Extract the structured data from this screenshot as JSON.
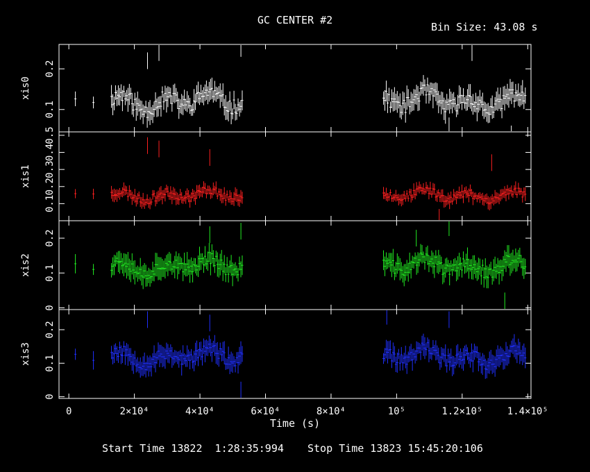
{
  "header": {
    "title": "GC CENTER #2",
    "bin_size": "Bin Size: 43.08 s",
    "x_axis_label": "Time (s)",
    "start_time": "Start Time 13822  1:28:35:994",
    "stop_time": "Stop Time 13823 15:45:20:106"
  },
  "chart_data": {
    "type": "line",
    "layout": "stacked-panels-sharing-x",
    "xlabel": "Time (s)",
    "xlim": [
      -3000,
      141000
    ],
    "x_ticks": [
      {
        "value": 0,
        "label": "0"
      },
      {
        "value": 20000,
        "label": "2×10⁴"
      },
      {
        "value": 40000,
        "label": "4×10⁴"
      },
      {
        "value": 60000,
        "label": "6×10⁴"
      },
      {
        "value": 80000,
        "label": "8×10⁴"
      },
      {
        "value": 100000,
        "label": "10⁵"
      },
      {
        "value": 120000,
        "label": "1.2×10⁵"
      },
      {
        "value": 140000,
        "label": "1.4×10⁵"
      }
    ],
    "segments": [
      [
        2000,
        2000
      ],
      [
        7500,
        7500
      ],
      [
        13000,
        53000
      ],
      [
        96000,
        139500
      ]
    ],
    "panels": [
      {
        "name": "xis0",
        "ylabel": "xis0",
        "color": "#ffffff",
        "ylim": [
          0.045,
          0.26
        ],
        "y_ticks": [
          {
            "value": 0.1,
            "label": "0.1"
          },
          {
            "value": 0.2,
            "label": "0.2"
          }
        ],
        "base": 0.12,
        "amp": 0.03,
        "err": 0.022,
        "seed": 11,
        "outliers": [
          [
            24000,
            0.22
          ],
          [
            27500,
            0.24
          ],
          [
            52500,
            0.25
          ],
          [
            116000,
            0.06
          ],
          [
            123000,
            0.24
          ],
          [
            135000,
            0.04
          ]
        ]
      },
      {
        "name": "xis1",
        "ylabel": "xis1",
        "color": "#ff2020",
        "ylim": [
          0.0,
          0.52
        ],
        "y_ticks": [
          {
            "value": 0.1,
            "label": "0.1"
          },
          {
            "value": 0.2,
            "label": "0.2"
          },
          {
            "value": 0.3,
            "label": "0.3"
          },
          {
            "value": 0.4,
            "label": "0.4"
          },
          {
            "value": 0.5,
            "label": "0.5"
          }
        ],
        "base": 0.15,
        "amp": 0.04,
        "err": 0.03,
        "seed": 23,
        "outliers": [
          [
            24000,
            0.44
          ],
          [
            27500,
            0.42
          ],
          [
            43000,
            0.37
          ],
          [
            113000,
            0.02
          ],
          [
            129000,
            0.34
          ]
        ]
      },
      {
        "name": "xis2",
        "ylabel": "xis2",
        "color": "#22ee22",
        "ylim": [
          -0.005,
          0.25
        ],
        "y_ticks": [
          {
            "value": 0,
            "label": "0"
          },
          {
            "value": 0.1,
            "label": "0.1"
          },
          {
            "value": 0.2,
            "label": "0.2"
          }
        ],
        "base": 0.12,
        "amp": 0.03,
        "err": 0.025,
        "seed": 37,
        "outliers": [
          [
            43000,
            0.21
          ],
          [
            52500,
            0.22
          ],
          [
            106000,
            0.2
          ],
          [
            116000,
            0.23
          ],
          [
            133000,
            0.02
          ]
        ]
      },
      {
        "name": "xis3",
        "ylabel": "xis3",
        "color": "#2030ff",
        "ylim": [
          -0.005,
          0.26
        ],
        "y_ticks": [
          {
            "value": 0,
            "label": "0"
          },
          {
            "value": 0.1,
            "label": "0.1"
          },
          {
            "value": 0.2,
            "label": "0.2"
          }
        ],
        "base": 0.12,
        "amp": 0.03,
        "err": 0.025,
        "seed": 53,
        "outliers": [
          [
            24000,
            0.23
          ],
          [
            43000,
            0.22
          ],
          [
            52500,
            0.02
          ],
          [
            97000,
            0.24
          ],
          [
            116000,
            0.23
          ]
        ]
      }
    ]
  }
}
